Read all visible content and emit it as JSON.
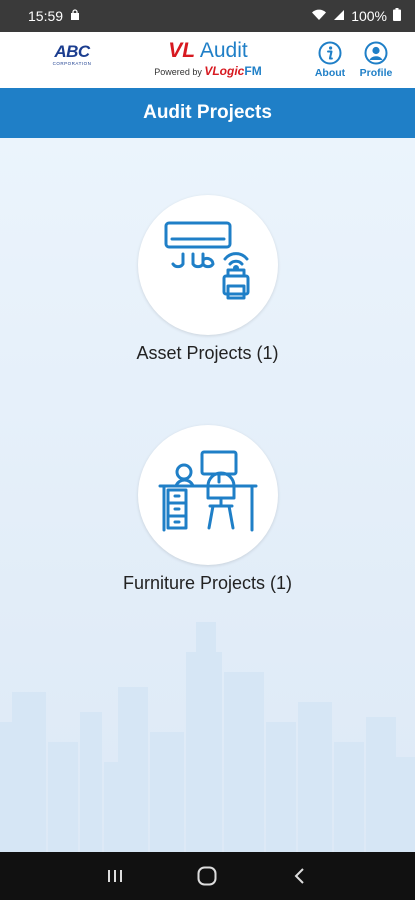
{
  "status_bar": {
    "time": "15:59",
    "battery": "100%"
  },
  "header": {
    "company_logo_text": "ABC",
    "company_logo_sub": "CORPORATION",
    "brand_vl": "VL",
    "brand_audit": "Audit",
    "powered_by": "Powered by",
    "brand_vlogic": "VLogic",
    "brand_fm": "FM",
    "about_label": "About",
    "profile_label": "Profile"
  },
  "title_bar": {
    "title": "Audit Projects"
  },
  "tiles": {
    "asset_label": "Asset Projects (1)",
    "furniture_label": "Furniture Projects (1)"
  },
  "colors": {
    "primary": "#1f7fc7",
    "brand_red": "#d71920",
    "status_bar": "#3a3a3a",
    "nav_bar": "#111111"
  },
  "icons": {
    "asset": "air-conditioner-printer-icon",
    "furniture": "desk-chair-icon",
    "about": "info-icon",
    "profile": "user-circle-icon"
  }
}
